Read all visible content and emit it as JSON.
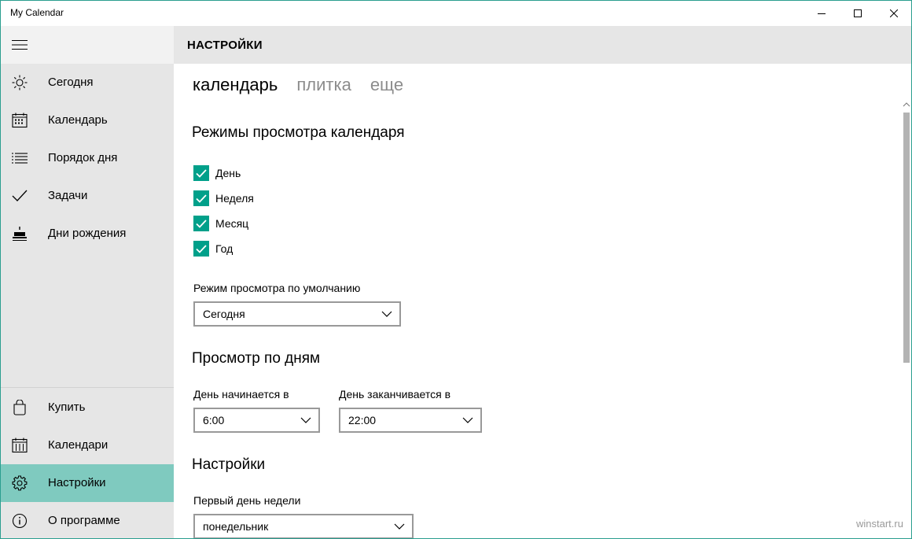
{
  "window": {
    "title": "My Calendar",
    "accent": "#00a08a",
    "selected_nav_color": "#7fcabf"
  },
  "titlebar_buttons": {
    "minimize_icon": "minimize-icon",
    "maximize_icon": "maximize-icon",
    "close_icon": "close-icon"
  },
  "sidebar": {
    "menu_icon": "hamburger-icon",
    "items": [
      {
        "label": "Сегодня",
        "icon": "sun-icon"
      },
      {
        "label": "Календарь",
        "icon": "calendar-icon"
      },
      {
        "label": "Порядок дня",
        "icon": "agenda-list-icon"
      },
      {
        "label": "Задачи",
        "icon": "checkmark-icon"
      },
      {
        "label": "Дни рождения",
        "icon": "birthday-cake-icon"
      }
    ],
    "bottom_items": [
      {
        "label": "Купить",
        "icon": "shopping-bag-icon"
      },
      {
        "label": "Календари",
        "icon": "calendars-icon"
      },
      {
        "label": "Настройки",
        "icon": "gear-icon",
        "selected": true
      },
      {
        "label": "О программе",
        "icon": "info-icon"
      }
    ]
  },
  "header": {
    "title": "НАСТРОЙКИ"
  },
  "tabs": [
    {
      "label": "календарь",
      "active": true
    },
    {
      "label": "плитка",
      "active": false
    },
    {
      "label": "еще",
      "active": false
    }
  ],
  "view_modes": {
    "title": "Режимы просмотра календаря",
    "options": [
      {
        "label": "День",
        "checked": true
      },
      {
        "label": "Неделя",
        "checked": true
      },
      {
        "label": "Месяц",
        "checked": true
      },
      {
        "label": "Год",
        "checked": true
      }
    ],
    "default_label": "Режим просмотра по умолчанию",
    "default_value": "Сегодня"
  },
  "day_view": {
    "title": "Просмотр по дням",
    "start_label": "День начинается в",
    "start_value": "6:00",
    "end_label": "День заканчивается в",
    "end_value": "22:00"
  },
  "settings": {
    "title": "Настройки",
    "first_day_label": "Первый день недели",
    "first_day_value": "понедельник"
  },
  "watermark": "winstart.ru"
}
